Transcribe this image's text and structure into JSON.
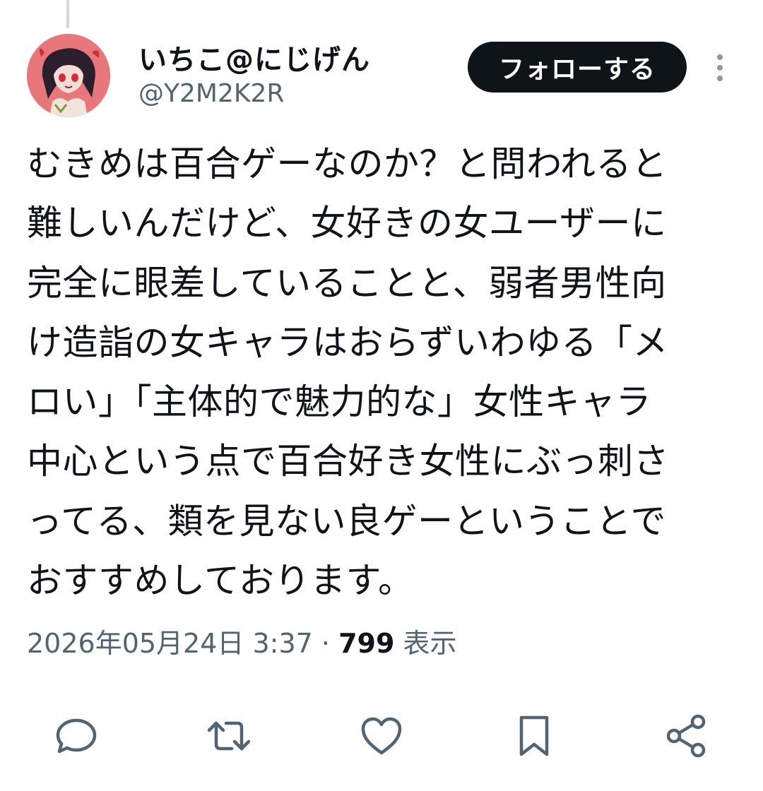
{
  "tweet": {
    "author_name": "いちこ@にじげん",
    "author_handle": "@Y2M2K2R",
    "follow_label": "フォローする",
    "text_lines": [
      "むきめは百合ゲーなのか？と問われると",
      "難しいんだけど、女好きの女ユーザーに",
      "完全に眼差していることと、弱者男性向",
      "け造詣の女キャラはおらずいわゆる「メ",
      "ロい」「主体的で魅力的な」女性キャラ",
      "中心という点で百合好き女性にぶっ刺さ",
      "ってる、類を見ない良ゲーということで",
      "おすすめしております。"
    ],
    "timestamp": "2026年05月24日 3:37",
    "separator": "·",
    "views_count": "799",
    "views_label": "表示"
  },
  "icons": {
    "avatar": "avatar-image",
    "more": "more-vertical-icon",
    "reply": "reply-icon",
    "retweet": "retweet-icon",
    "like": "like-icon",
    "bookmark": "bookmark-icon",
    "share": "share-icon"
  },
  "colors": {
    "text": "#0f1419",
    "secondary": "#536471",
    "button_bg": "#0f1419",
    "avatar_bg": "#e8777c"
  }
}
